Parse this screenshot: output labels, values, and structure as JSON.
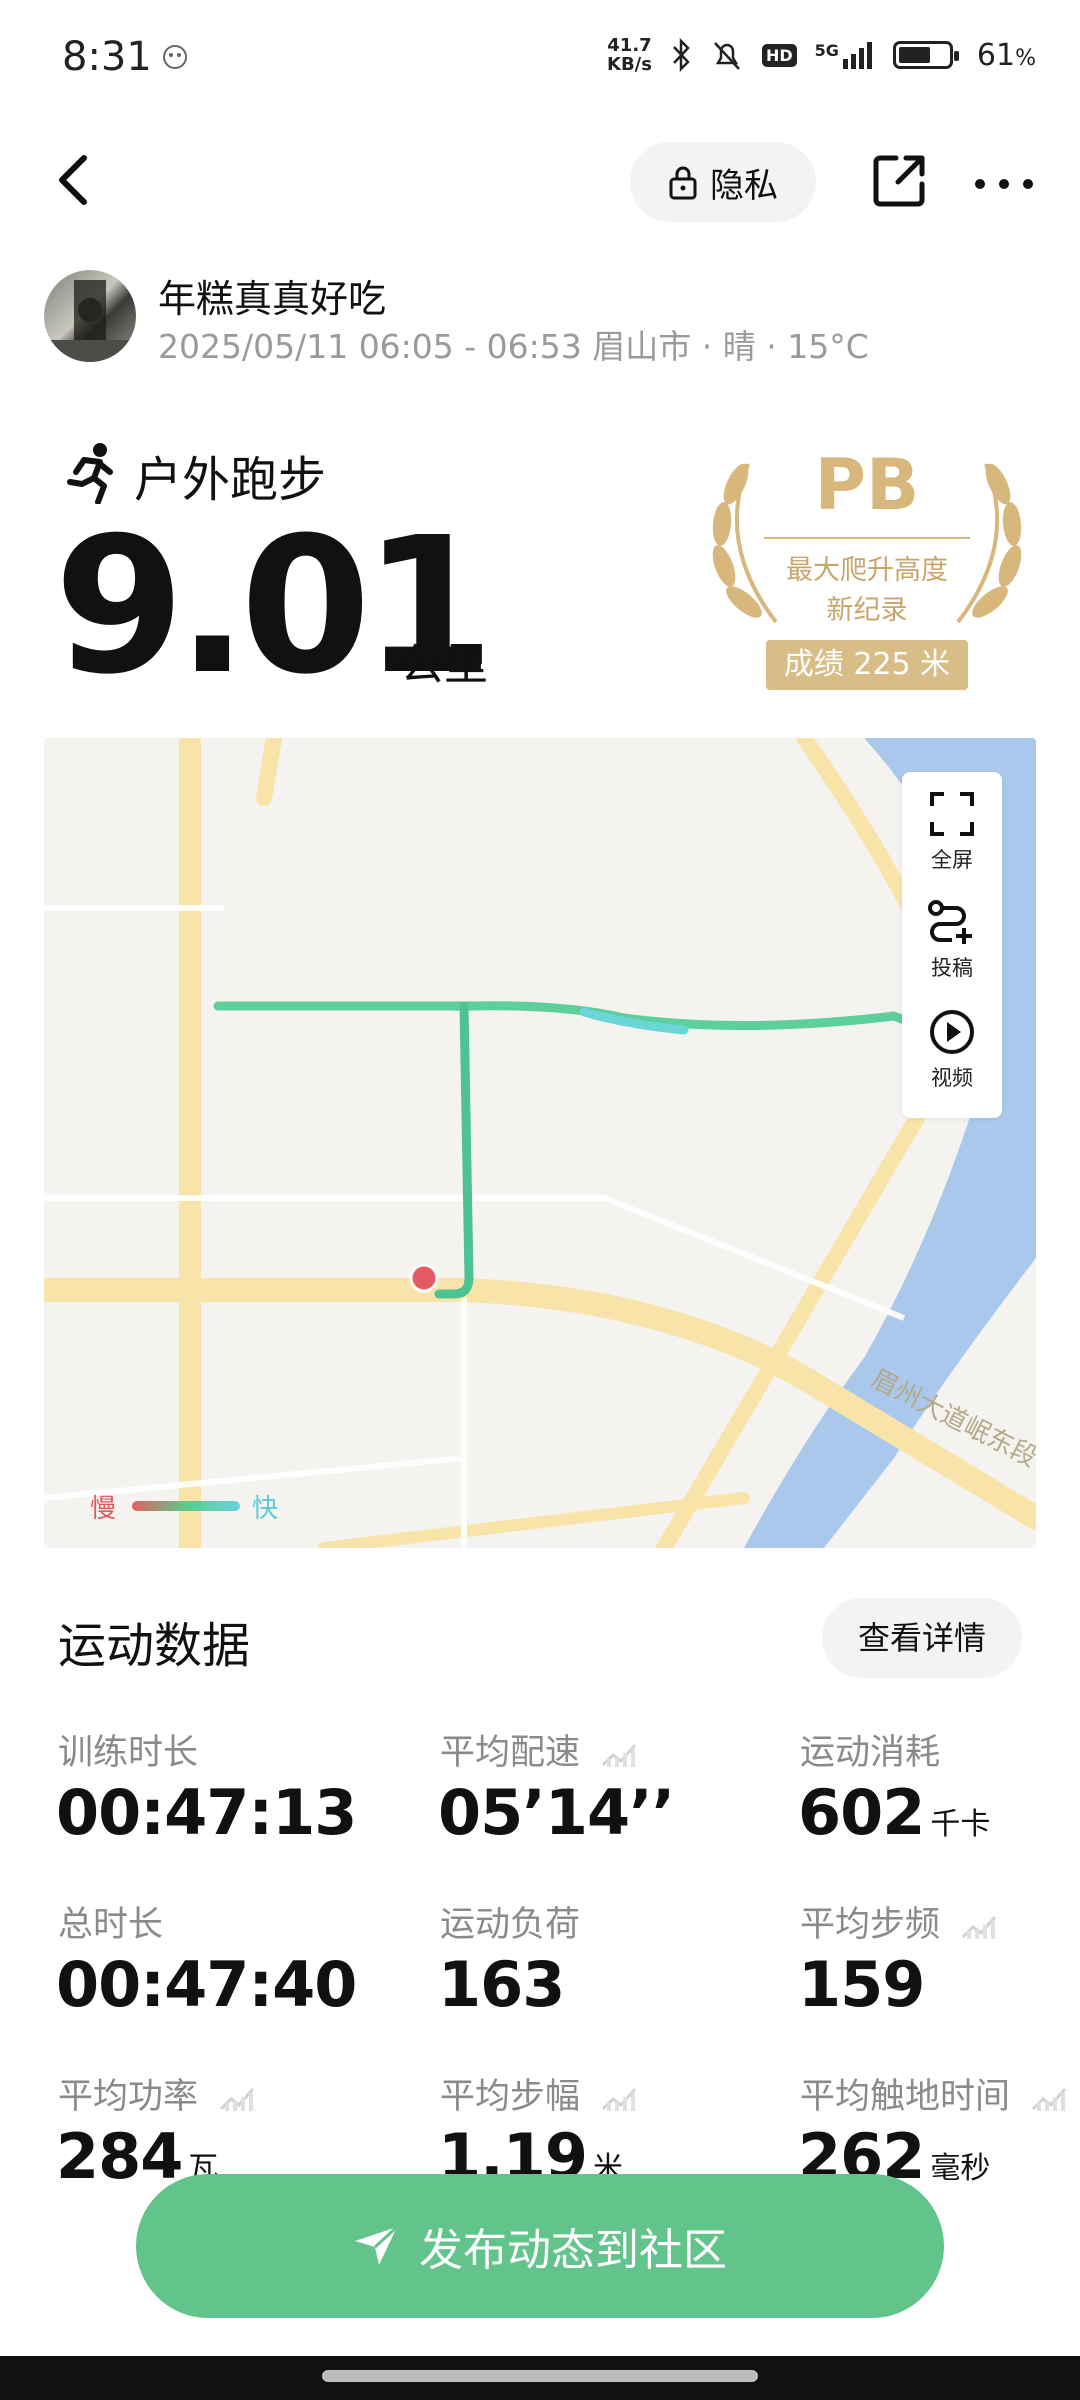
{
  "status": {
    "time": "8:31",
    "net_speed_value": "41.7",
    "net_speed_unit": "KB/s",
    "hd": "HD",
    "signal": "5G",
    "battery": "61",
    "battery_unit": "%"
  },
  "header": {
    "privacy_label": "隐私"
  },
  "user": {
    "name": "年糕真真好吃",
    "meta": "2025/05/11 06:05 - 06:53 眉山市 · 晴 · 15°C"
  },
  "sport": {
    "type": "户外跑步",
    "distance": "9.01",
    "distance_unit": "公里"
  },
  "pb": {
    "title": "PB",
    "line1": "最大爬升高度",
    "line2": "新纪录",
    "result": "成绩 225 米"
  },
  "map": {
    "tools": [
      {
        "label": "全屏",
        "icon": "fullscreen-icon"
      },
      {
        "label": "投稿",
        "icon": "route-add-icon"
      },
      {
        "label": "视频",
        "icon": "play-icon"
      }
    ],
    "legend_slow": "慢",
    "legend_fast": "快",
    "road_label": "眉州大道岷东段"
  },
  "data_section": {
    "title": "运动数据",
    "detail_button": "查看详情",
    "metrics": [
      {
        "label": "训练时长",
        "value": "00:47:13",
        "unit": ""
      },
      {
        "label": "平均配速",
        "value": "05’14’’",
        "unit": ""
      },
      {
        "label": "运动消耗",
        "value": "602",
        "unit": "千卡"
      },
      {
        "label": "总时长",
        "value": "00:47:40",
        "unit": ""
      },
      {
        "label": "运动负荷",
        "value": "163",
        "unit": ""
      },
      {
        "label": "平均步频",
        "value": "159",
        "unit": ""
      },
      {
        "label": "平均功率",
        "value": "284",
        "unit": "瓦"
      },
      {
        "label": "平均步幅",
        "value": "1.19",
        "unit": "米"
      },
      {
        "label": "平均触地时间",
        "value": "262",
        "unit": "毫秒"
      }
    ]
  },
  "publish": {
    "label": "发布动态到社区"
  }
}
